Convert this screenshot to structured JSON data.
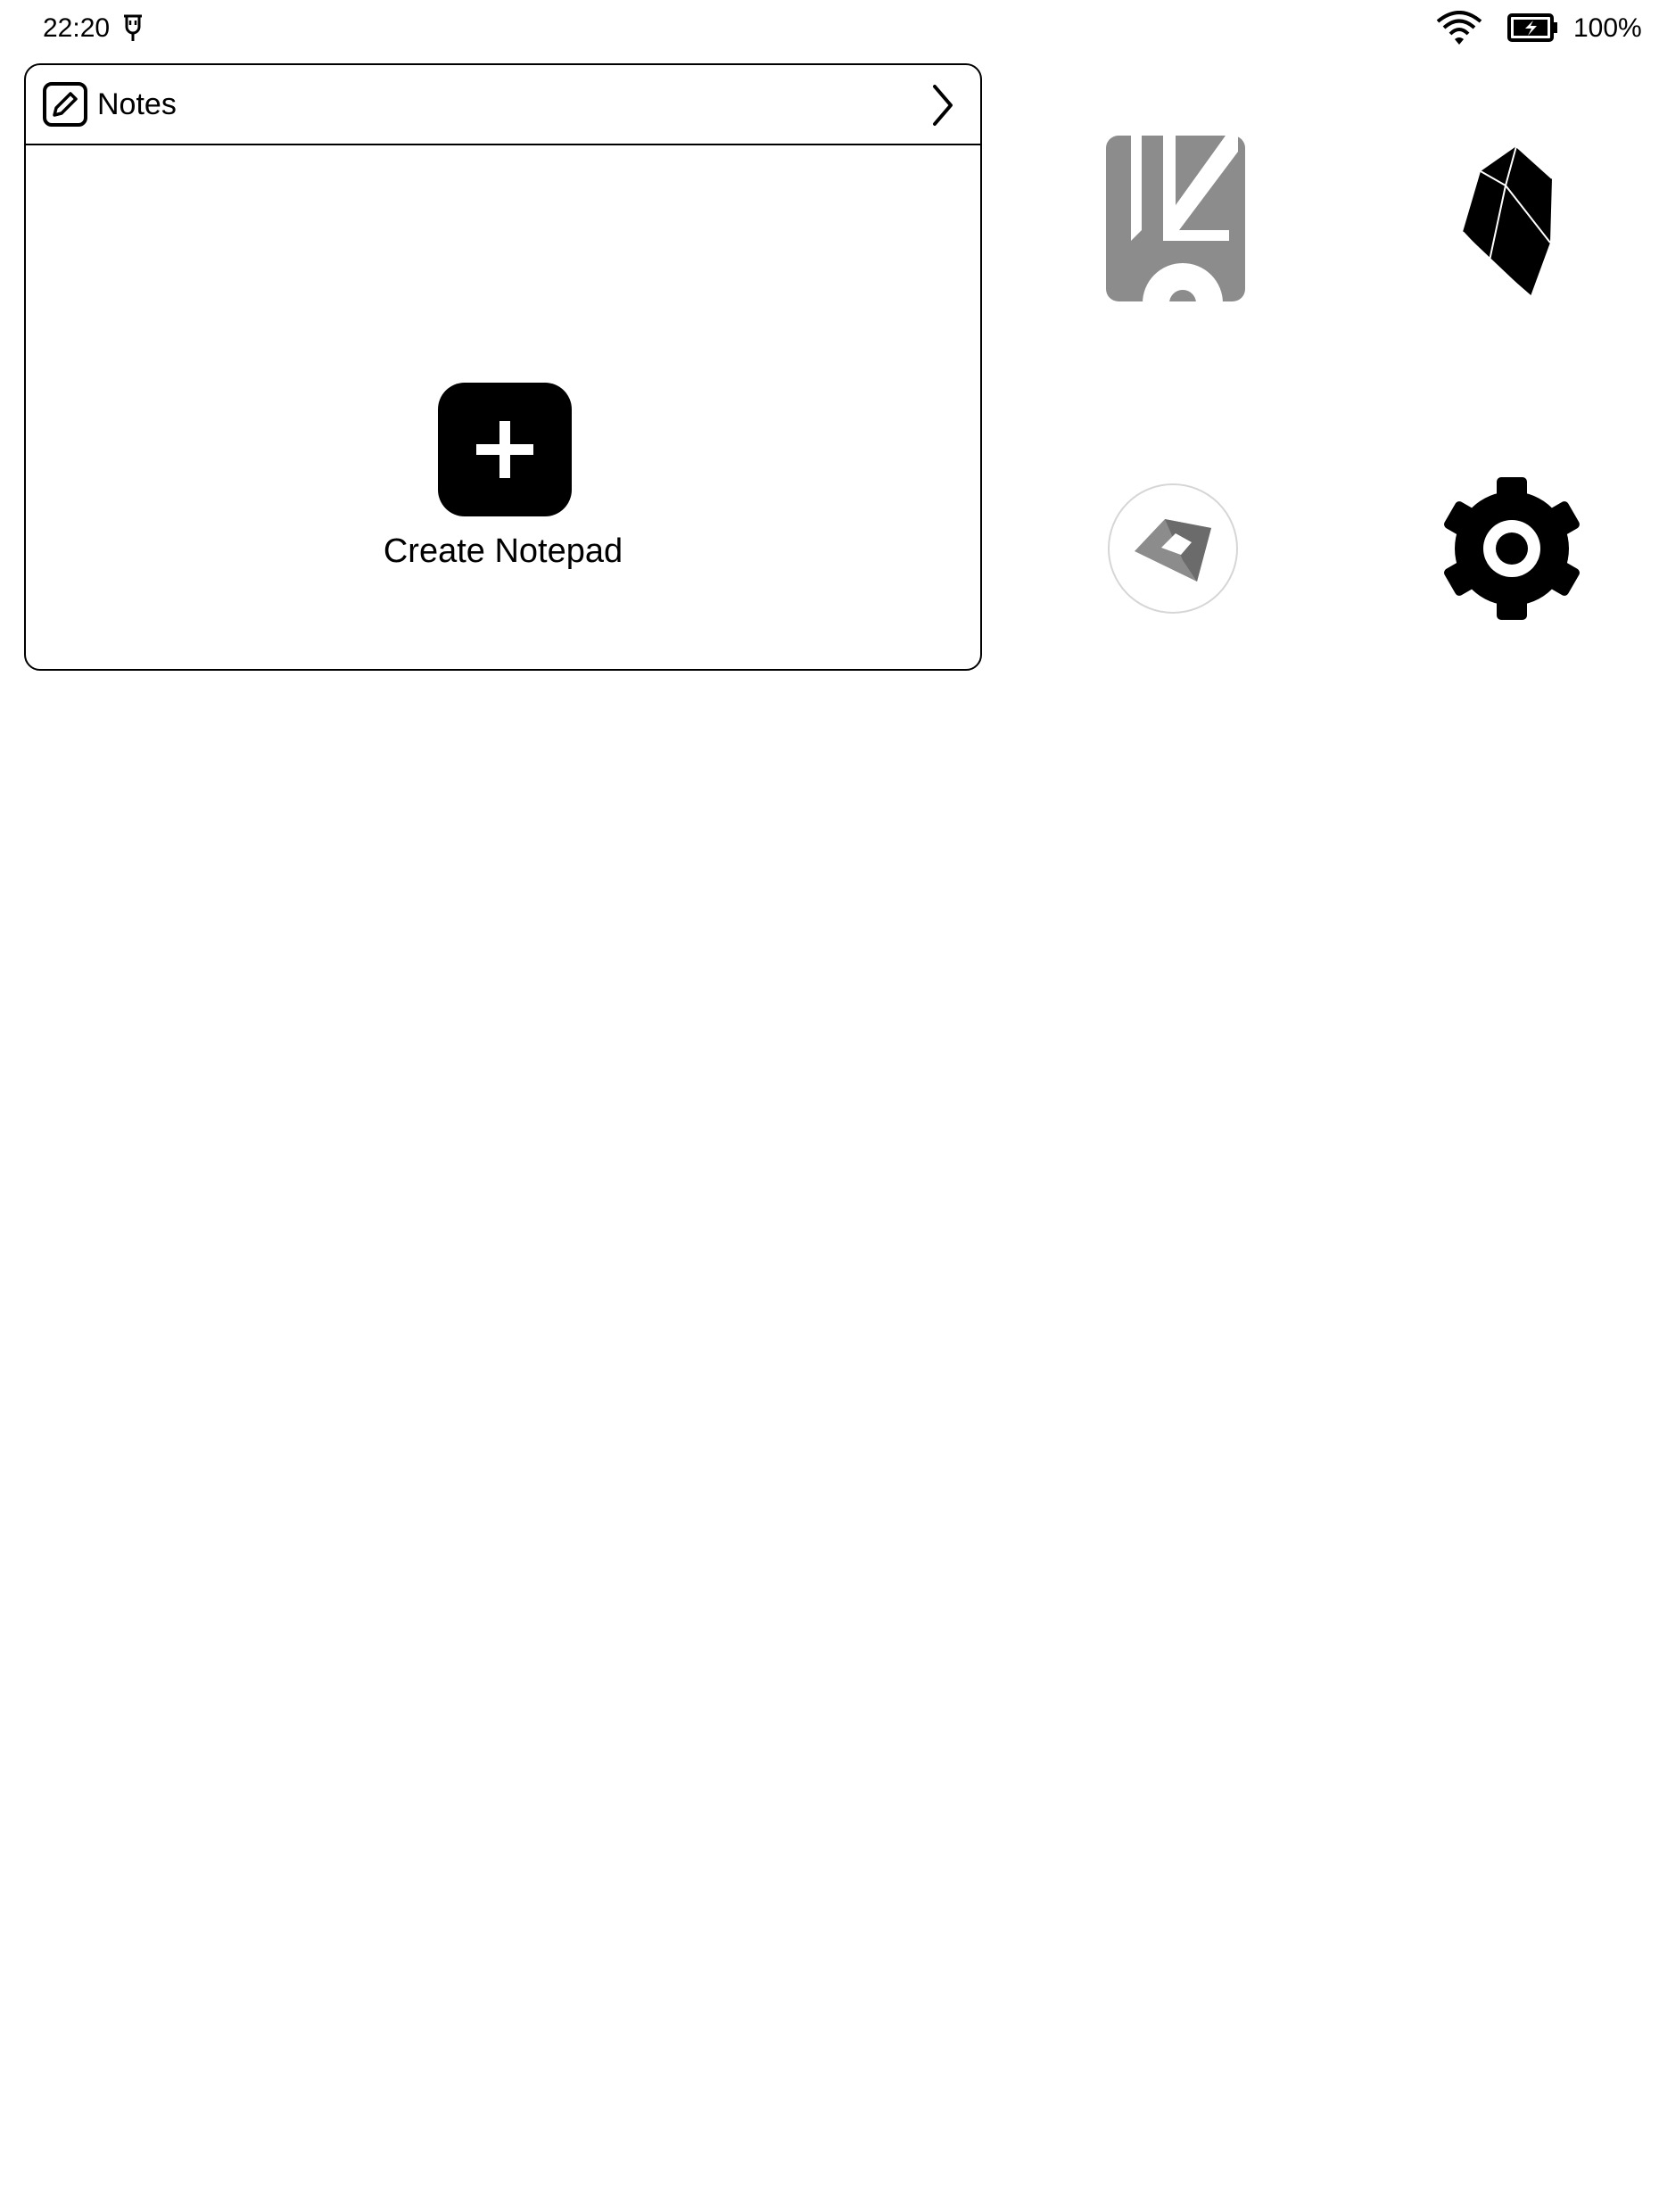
{
  "status_bar": {
    "time": "22:20",
    "usb_icon": "usb-icon",
    "wifi_icon": "wifi-icon",
    "battery_icon": "battery-charging-icon",
    "battery_percent": "100%"
  },
  "notes_widget": {
    "icon": "pencil-square-icon",
    "title": "Notes",
    "chevron_icon": "chevron-right-icon",
    "create_icon": "plus-square-icon",
    "create_label": "Create Notepad"
  },
  "apps": [
    {
      "icon": "koreader-app-icon"
    },
    {
      "icon": "obsidian-app-icon"
    },
    {
      "icon": "gem-app-icon"
    },
    {
      "icon": "settings-gear-icon"
    }
  ],
  "colors": {
    "foreground": "#000000",
    "background": "#ffffff",
    "icon_gray": "#8c8c8c"
  }
}
